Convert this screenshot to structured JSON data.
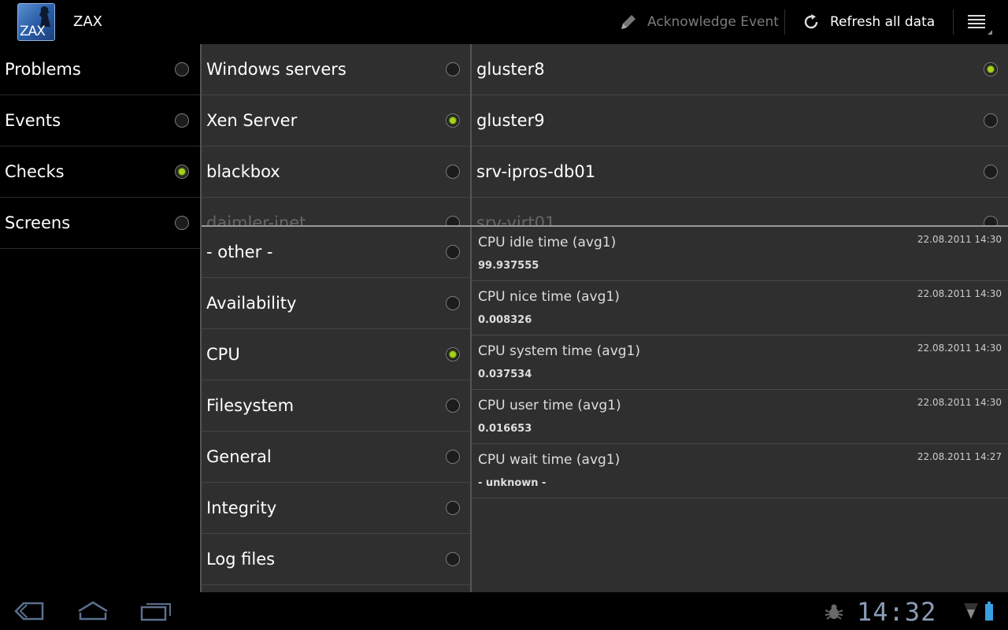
{
  "app": {
    "title": "ZAX",
    "icon_text": "ZAX"
  },
  "actionbar": {
    "acknowledge_label": "Acknowledge Event",
    "refresh_label": "Refresh all data"
  },
  "nav": {
    "items": [
      {
        "label": "Problems",
        "selected": false
      },
      {
        "label": "Events",
        "selected": false
      },
      {
        "label": "Checks",
        "selected": true
      },
      {
        "label": "Screens",
        "selected": false
      }
    ]
  },
  "hostgroups": {
    "items": [
      {
        "label": "Windows servers",
        "selected": false
      },
      {
        "label": "Xen Server",
        "selected": true
      },
      {
        "label": "blackbox",
        "selected": false
      },
      {
        "label": "daimler-inet",
        "selected": false
      }
    ]
  },
  "hosts": {
    "items": [
      {
        "label": "gluster8",
        "selected": true
      },
      {
        "label": "gluster9",
        "selected": false
      },
      {
        "label": "srv-ipros-db01",
        "selected": false
      },
      {
        "label": "srv-virt01",
        "selected": false
      }
    ]
  },
  "applications": {
    "items": [
      {
        "label": "- other -",
        "selected": false
      },
      {
        "label": "Availability",
        "selected": false
      },
      {
        "label": "CPU",
        "selected": true
      },
      {
        "label": "Filesystem",
        "selected": false
      },
      {
        "label": "General",
        "selected": false
      },
      {
        "label": "Integrity",
        "selected": false
      },
      {
        "label": "Log files",
        "selected": false
      }
    ]
  },
  "items": [
    {
      "name": "CPU idle time (avg1)",
      "value": "99.937555",
      "time": "22.08.2011 14:30"
    },
    {
      "name": "CPU nice time (avg1)",
      "value": "0.008326",
      "time": "22.08.2011 14:30"
    },
    {
      "name": "CPU system time (avg1)",
      "value": "0.037534",
      "time": "22.08.2011 14:30"
    },
    {
      "name": "CPU user time (avg1)",
      "value": "0.016653",
      "time": "22.08.2011 14:30"
    },
    {
      "name": "CPU wait time (avg1)",
      "value": "- unknown -",
      "time": "22.08.2011 14:27"
    }
  ],
  "system": {
    "clock": "14:32"
  },
  "colors": {
    "accent": "#a4d31a",
    "panel": "#2f2f2f",
    "background": "#000000"
  }
}
